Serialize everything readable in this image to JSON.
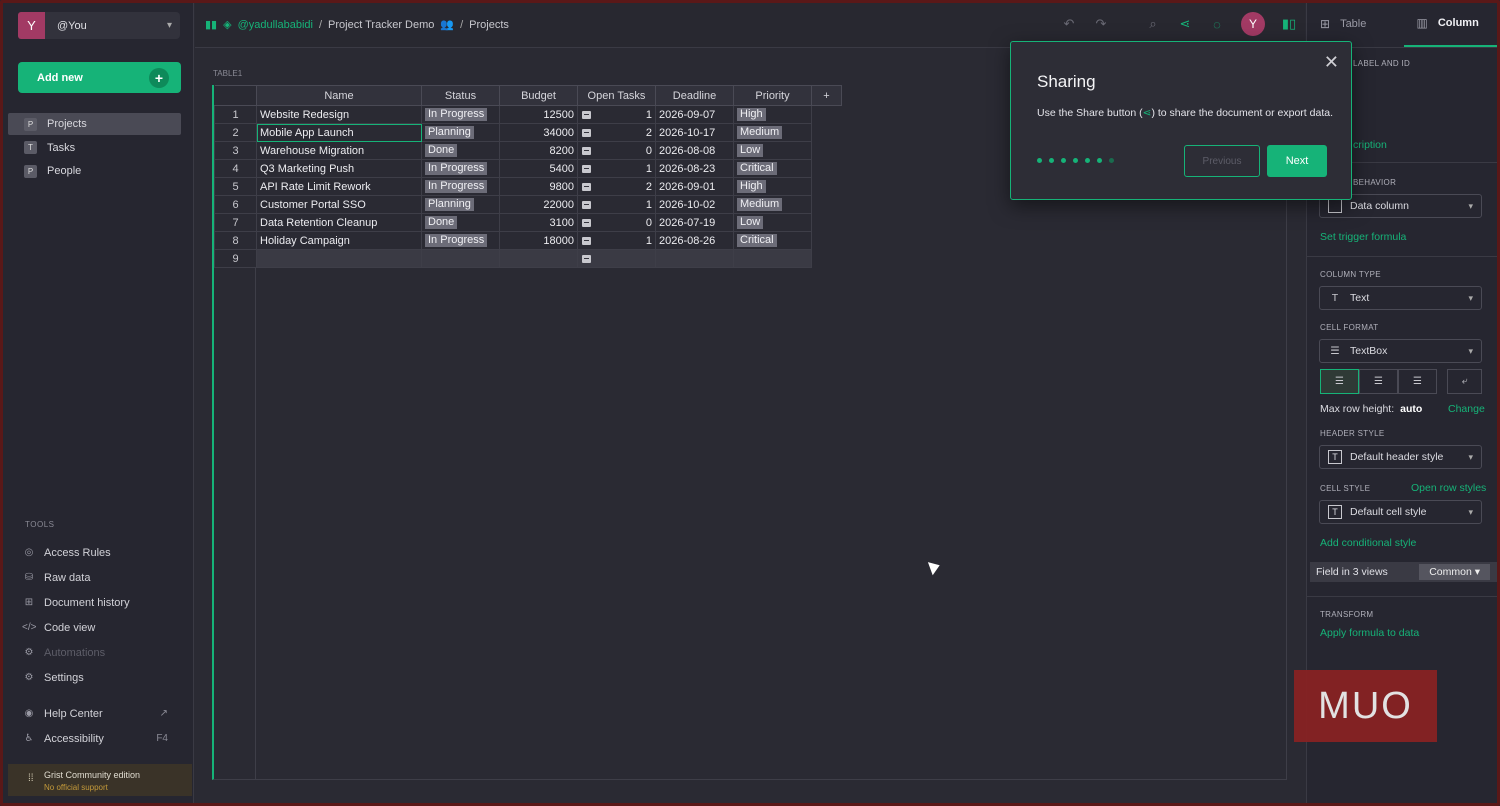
{
  "sidebar": {
    "org_initial": "Y",
    "org_name": "@You",
    "add_new": "Add new",
    "pages": [
      {
        "icon": "P",
        "label": "Projects"
      },
      {
        "icon": "T",
        "label": "Tasks"
      },
      {
        "icon": "P",
        "label": "People"
      }
    ],
    "tools_header": "TOOLS",
    "tools": [
      {
        "label": "Access Rules"
      },
      {
        "label": "Raw data"
      },
      {
        "label": "Document history"
      },
      {
        "label": "Code view"
      },
      {
        "label": "Automations"
      },
      {
        "label": "Settings"
      }
    ],
    "help_center": "Help Center",
    "accessibility": "Accessibility",
    "accessibility_key": "F4",
    "edition": "Grist Community edition",
    "support": "No official support"
  },
  "topbar": {
    "owner": "@yadullababidi",
    "doc": "Project Tracker Demo",
    "page": "Projects",
    "user_initial": "Y"
  },
  "grid": {
    "table_label": "TABLE1",
    "columns": [
      "Name",
      "Status",
      "Budget",
      "Open Tasks",
      "Deadline",
      "Priority"
    ],
    "add_col": "+",
    "rows": [
      {
        "n": "1",
        "name": "Website Redesign",
        "status": "In Progress",
        "budget": "12500",
        "tasks": "1",
        "deadline": "2026-09-07",
        "priority": "High"
      },
      {
        "n": "2",
        "name": "Mobile App Launch",
        "status": "Planning",
        "budget": "34000",
        "tasks": "2",
        "deadline": "2026-10-17",
        "priority": "Medium"
      },
      {
        "n": "3",
        "name": "Warehouse Migration",
        "status": "Done",
        "budget": "8200",
        "tasks": "0",
        "deadline": "2026-08-08",
        "priority": "Low"
      },
      {
        "n": "4",
        "name": "Q3 Marketing Push",
        "status": "In Progress",
        "budget": "5400",
        "tasks": "1",
        "deadline": "2026-08-23",
        "priority": "Critical"
      },
      {
        "n": "5",
        "name": "API Rate Limit Rework",
        "status": "In Progress",
        "budget": "9800",
        "tasks": "2",
        "deadline": "2026-09-01",
        "priority": "High"
      },
      {
        "n": "6",
        "name": "Customer Portal SSO",
        "status": "Planning",
        "budget": "22000",
        "tasks": "1",
        "deadline": "2026-10-02",
        "priority": "Medium"
      },
      {
        "n": "7",
        "name": "Data Retention Cleanup",
        "status": "Done",
        "budget": "3100",
        "tasks": "0",
        "deadline": "2026-07-19",
        "priority": "Low"
      },
      {
        "n": "8",
        "name": "Holiday Campaign",
        "status": "In Progress",
        "budget": "18000",
        "tasks": "1",
        "deadline": "2026-08-26",
        "priority": "Critical"
      }
    ],
    "new_row_num": "9"
  },
  "popup": {
    "title": "Sharing",
    "body_pre": "Use the Share button (",
    "body_post": ") to share the document or export data.",
    "previous": "Previous",
    "next": "Next",
    "step_count": 6,
    "current_step": 6
  },
  "right_panel": {
    "tab_table": "Table",
    "tab_column": "Column",
    "label_and_id": "LABEL AND ID",
    "description_link": "cription",
    "behavior_header": "BEHAVIOR",
    "behavior_value": "Data column",
    "set_trigger": "Set trigger formula",
    "column_type_h": "COLUMN TYPE",
    "column_type": "Text",
    "cell_format_h": "CELL FORMAT",
    "cell_format": "TextBox",
    "max_row_height_label": "Max row height:",
    "max_row_height_value": "auto",
    "change": "Change",
    "header_style_h": "HEADER STYLE",
    "header_style": "Default header style",
    "cell_style_h": "CELL STYLE",
    "open_row_styles": "Open row styles",
    "cell_style": "Default cell style",
    "add_conditional": "Add conditional style",
    "field_in_views": "Field in 3 views",
    "common": "Common ▾",
    "transform_h": "TRANSFORM",
    "apply_formula": "Apply formula to data"
  },
  "watermark": "MUO",
  "colors": {
    "accent": "#16b378",
    "avatar": "#a23a64",
    "background": "#2a2a33"
  }
}
